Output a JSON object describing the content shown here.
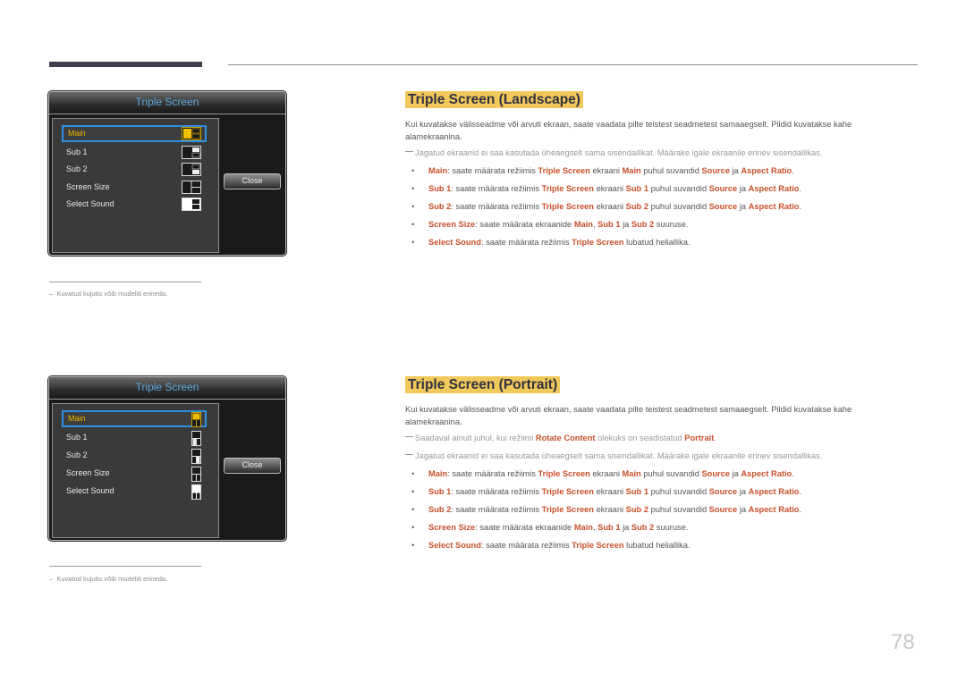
{
  "page_number": "78",
  "osd": {
    "title": "Triple Screen",
    "close_label": "Close",
    "items": [
      {
        "label": "Main",
        "selected": true
      },
      {
        "label": "Sub 1",
        "selected": false
      },
      {
        "label": "Sub 2",
        "selected": false
      },
      {
        "label": "Screen Size",
        "selected": false
      },
      {
        "label": "Select Sound",
        "selected": false
      }
    ]
  },
  "footnote": "Kuvatud kujutis võib mudeliti erineda.",
  "footnote_dash": "–",
  "landscape": {
    "title": "Triple Screen (Landscape)",
    "intro": "Kui kuvatakse välisseadme või arvuti ekraan, saate vaadata pilte teistest seadmetest samaaegselt. Pildid kuvatakse kahe alamekraanina.",
    "notes": [
      "Jagatud ekraanid ei saa kasutada üheaegselt sama sisendallikat. Määrake igale ekraanile erinev sisendallikas."
    ]
  },
  "portrait": {
    "title": "Triple Screen (Portrait)",
    "intro": "Kui kuvatakse välisseadme või arvuti ekraan, saate vaadata pilte teistest seadmetest samaaegselt. Pildid kuvatakse kahe alamekraanina.",
    "note1": {
      "pre": "Saadaval ainult juhul, kui režiimi ",
      "hl1": "Rotate Content",
      "mid": " olekuks on seadistatud ",
      "hl2": "Portrait",
      "post": "."
    },
    "notes": [
      "Jagatud ekraanid ei saa kasutada üheaegselt sama sisendallikat. Määrake igale ekraanile erinev sisendallikas."
    ]
  },
  "bullets": {
    "main": {
      "k": "Main",
      "t1": ": saate määrata režiimis ",
      "h1": "Triple Screen",
      "t2": " ekraani ",
      "h2": "Main",
      "t3": " puhul suvandid ",
      "h3": "Source",
      "t4": " ja ",
      "h4": "Aspect Ratio",
      "t5": "."
    },
    "sub1": {
      "k": "Sub 1",
      "t1": ": saate määrata režiimis ",
      "h1": "Triple Screen",
      "t2": " ekraani ",
      "h2": "Sub 1",
      "t3": " puhul suvandid ",
      "h3": "Source",
      "t4": " ja ",
      "h4": "Aspect Ratio",
      "t5": "."
    },
    "sub2": {
      "k": "Sub 2",
      "t1": ": saate määrata režiimis ",
      "h1": "Triple Screen",
      "t2": " ekraani ",
      "h2": "Sub 2",
      "t3": " puhul suvandid ",
      "h3": "Source",
      "t4": " ja ",
      "h4": "Aspect Ratio",
      "t5": "."
    },
    "size": {
      "k": "Screen Size",
      "t1": ": saate määrata ekraanide ",
      "h1": "Main",
      "t2": ", ",
      "h2": "Sub 1",
      "t3": " ja ",
      "h3": "Sub 2",
      "t4": " suuruse."
    },
    "sound": {
      "k": "Select Sound",
      "t1": ": saate määrata režiimis ",
      "h1": "Triple Screen",
      "t2": " lubatud heliallika."
    },
    "bullet_char": "•"
  }
}
